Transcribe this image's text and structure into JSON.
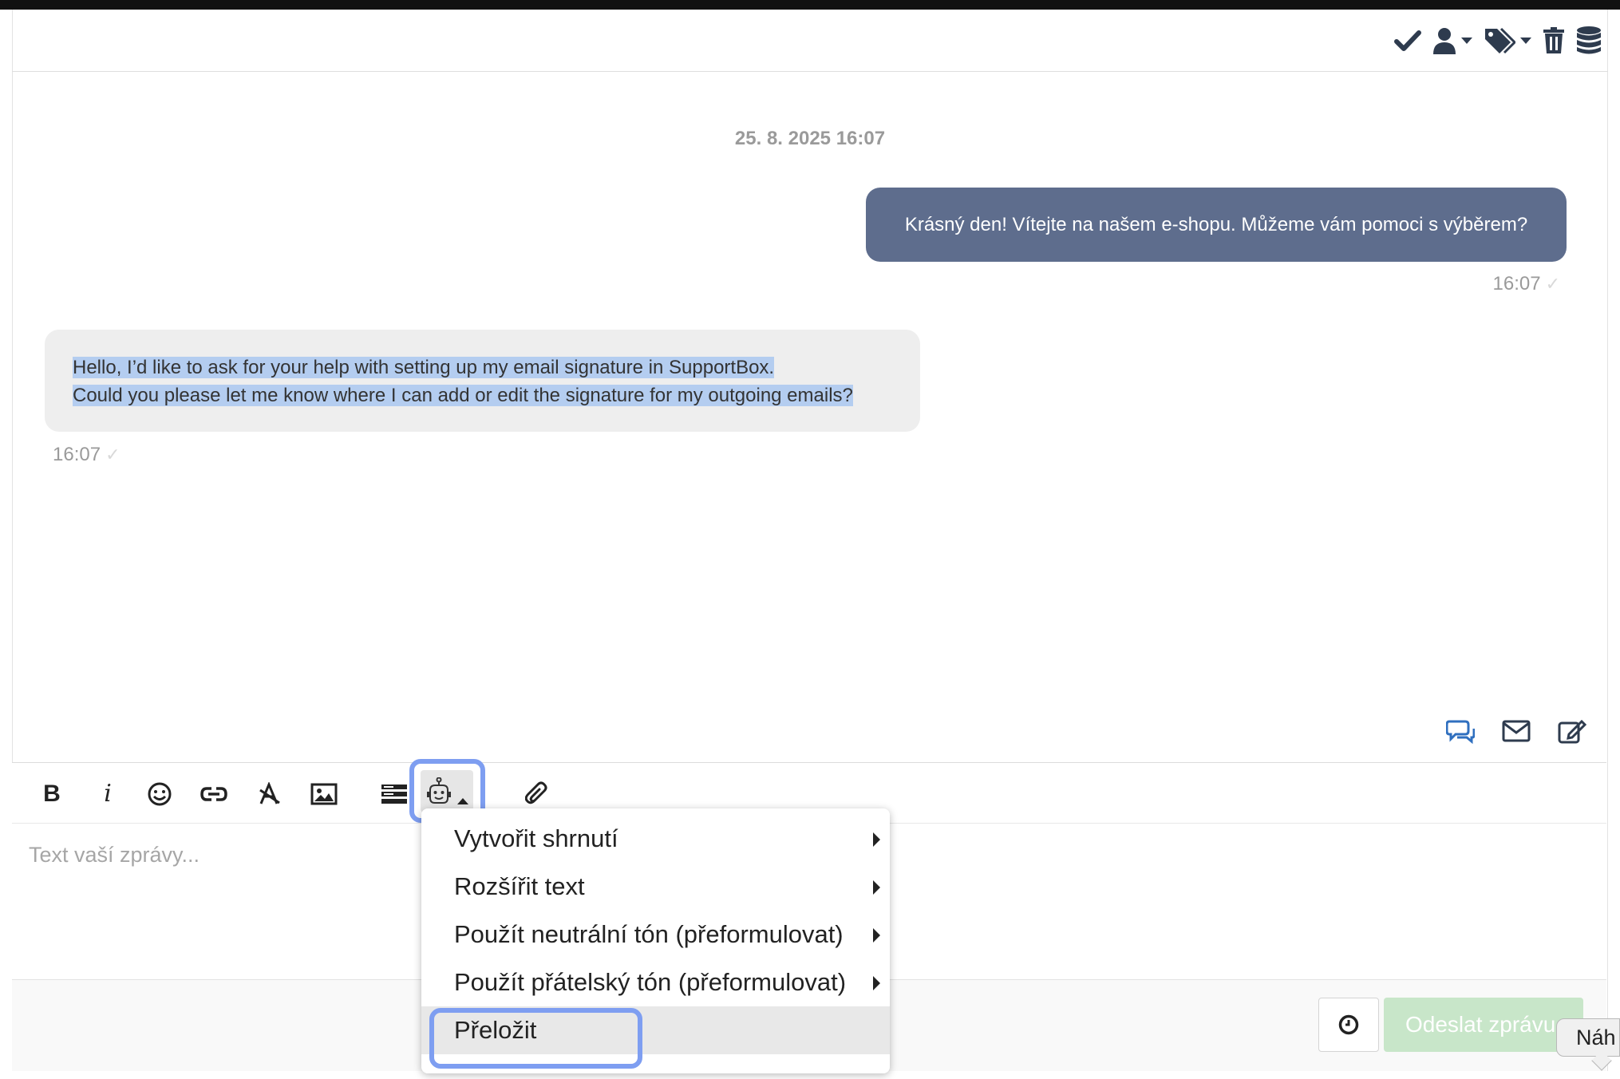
{
  "header": {
    "icons": [
      "check-icon",
      "user-icon",
      "tags-icon",
      "trash-icon",
      "database-icon"
    ]
  },
  "chat": {
    "date": "25. 8. 2025 16:07",
    "outgoing": {
      "text": "Krásný den! Vítejte na našem e-shopu. Můžeme vám pomoci s výběrem?",
      "time": "16:07"
    },
    "incoming": {
      "line1": "Hello, I’d like to ask for your help with setting up my email signature in SupportBox.",
      "line2": "Could you please let me know where I can add or edit the signature for my outgoing emails?",
      "time": "16:07"
    }
  },
  "reply_modes": [
    "chat-icon",
    "email-icon",
    "note-icon"
  ],
  "editor": {
    "toolbar": {
      "bold": "B",
      "italic": "i"
    },
    "placeholder": "Text vaší zprávy...",
    "send_label": "Odeslat zprávu",
    "tooltip": "Náh"
  },
  "ai_menu": {
    "items": [
      {
        "label": "Vytvořit shrnutí"
      },
      {
        "label": "Rozšířit text"
      },
      {
        "label": "Použít neutrální tón (přeformulovat)"
      },
      {
        "label": "Použít přátelský tón (přeformulovat)"
      },
      {
        "label": "Přeložit"
      }
    ]
  },
  "colors": {
    "outgoing_bubble": "#5e6d8d",
    "incoming_bubble": "#eeeeee",
    "selection": "#b4cdf0",
    "highlight": "#7e9ef1",
    "send_button": "#c8e6c9",
    "icons": "#2e3b4e",
    "accent_blue": "#2f6fbf"
  }
}
